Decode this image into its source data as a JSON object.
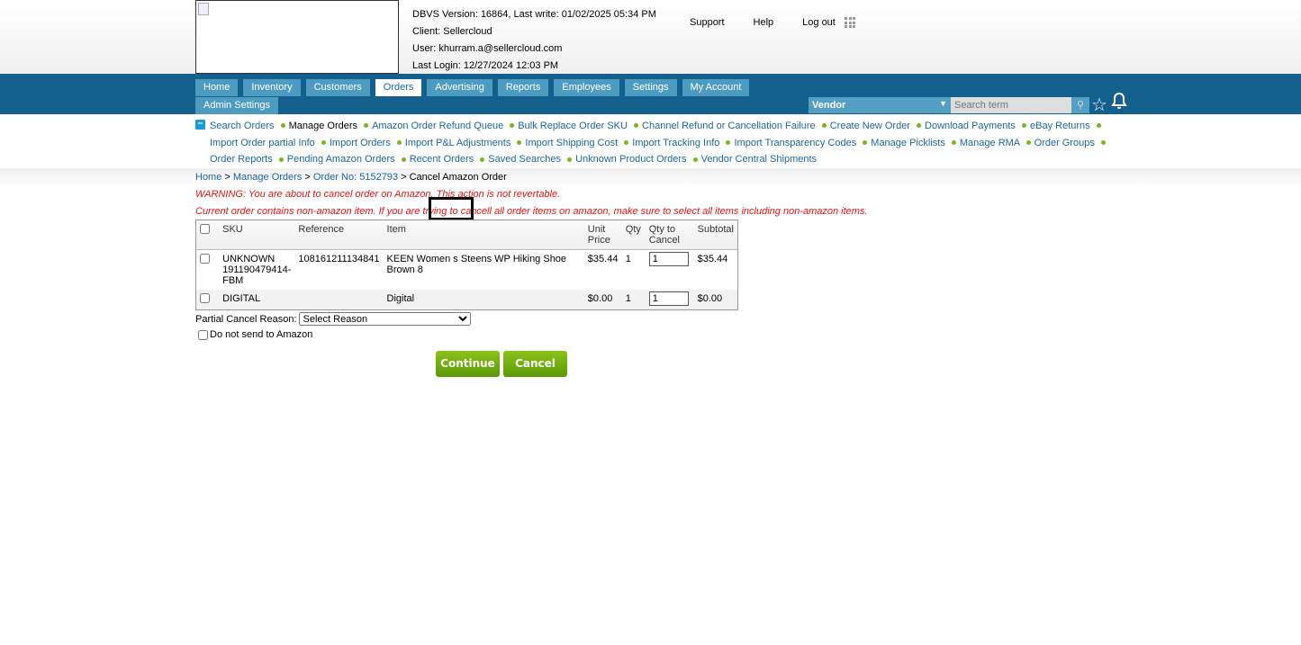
{
  "header": {
    "info": [
      "DBVS Version: 16864, Last write: 01/02/2025 05:34 PM",
      "Client: Sellercloud",
      "User: khurram.a@sellercloud.com",
      "Last Login: 12/27/2024 12:03 PM"
    ],
    "links": [
      "Support",
      "Help",
      "Log out"
    ]
  },
  "nav": {
    "tabs": [
      "Home",
      "Inventory",
      "Customers",
      "Orders",
      "Advertising",
      "Reports",
      "Employees",
      "Settings",
      "My Account",
      "Admin Settings"
    ],
    "active": "Orders",
    "vendor": "Vendor",
    "search_placeholder": "Search term"
  },
  "subnav": [
    "Search Orders",
    "Manage Orders",
    "Amazon Order Refund Queue",
    "Bulk Replace Order SKU",
    "Channel Refund or Cancellation Failure",
    "Create New Order",
    "Download Payments",
    "eBay Returns",
    "Import Order partial Info",
    "Import Orders",
    "Import P&L Adjustments",
    "Import Shipping Cost",
    "Import Tracking Info",
    "Import Transparency Codes",
    "Manage Picklists",
    "Manage RMA",
    "Order Groups",
    "Order Reports",
    "Pending Amazon Orders",
    "Recent Orders",
    "Saved Searches",
    "Unknown Product Orders",
    "Vendor Central Shipments"
  ],
  "breadcrumb": [
    "Home",
    "Manage Orders",
    "Order No: 5152793",
    "Cancel Amazon Order"
  ],
  "warning1": "WARNING: You are about to cancel order on Amazon. This action is not revertable.",
  "warning2": "Current order contains non-amazon item. If you are trying to cancell all order items on amazon, make sure to select all items including non-amazon items.",
  "table": {
    "headers": [
      "SKU",
      "Reference",
      "Item",
      "Unit Price",
      "Qty",
      "Qty to Cancel",
      "Subtotal"
    ],
    "rows": [
      {
        "sku": "UNKNOWN 191190479414-FBM",
        "reference": "108161211134841",
        "item": "KEEN Women s Steens WP Hiking Shoe Brown 8",
        "unit_price": "$35.44",
        "qty": "1",
        "qty_cancel": "1",
        "subtotal": "$35.44"
      },
      {
        "sku": "DIGITAL",
        "reference": "",
        "item": "Digital",
        "unit_price": "$0.00",
        "qty": "1",
        "qty_cancel": "1",
        "subtotal": "$0.00"
      }
    ]
  },
  "form": {
    "reason_label": "Partial Cancel Reason:",
    "reason_value": "Select Reason",
    "dns_label": "Do not send to Amazon",
    "continue": "Continue",
    "cancel": "Cancel"
  }
}
